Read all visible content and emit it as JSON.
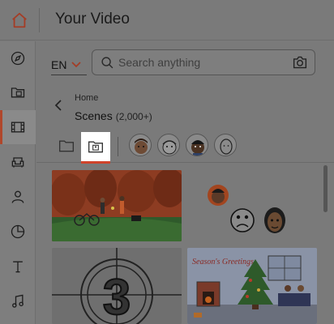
{
  "header": {
    "title": "Your Video"
  },
  "sidebar": {
    "items": [
      {
        "name": "explore",
        "icon": "compass-icon"
      },
      {
        "name": "my-videos",
        "icon": "video-folder-icon"
      },
      {
        "name": "scenes",
        "icon": "film-icon",
        "active": true
      },
      {
        "name": "furniture",
        "icon": "armchair-icon"
      },
      {
        "name": "characters",
        "icon": "person-icon"
      },
      {
        "name": "charts",
        "icon": "pie-chart-icon"
      },
      {
        "name": "text",
        "icon": "text-icon"
      },
      {
        "name": "music",
        "icon": "music-note-icon"
      }
    ]
  },
  "toolbar": {
    "language": "EN",
    "search_placeholder": "Search anything"
  },
  "browser": {
    "breadcrumb": "Home",
    "section_title": "Scenes",
    "section_count": "(2,000+)"
  },
  "scene_thumbs": [
    {
      "name": "park-scene"
    },
    {
      "name": "characters-emoji-scene"
    },
    {
      "name": "countdown-scene",
      "number": "3"
    },
    {
      "name": "seasons-greetings-scene",
      "caption": "Season's Greetings"
    }
  ],
  "colors": {
    "accent": "#d0442b",
    "overlay": "#7a7a7a"
  }
}
